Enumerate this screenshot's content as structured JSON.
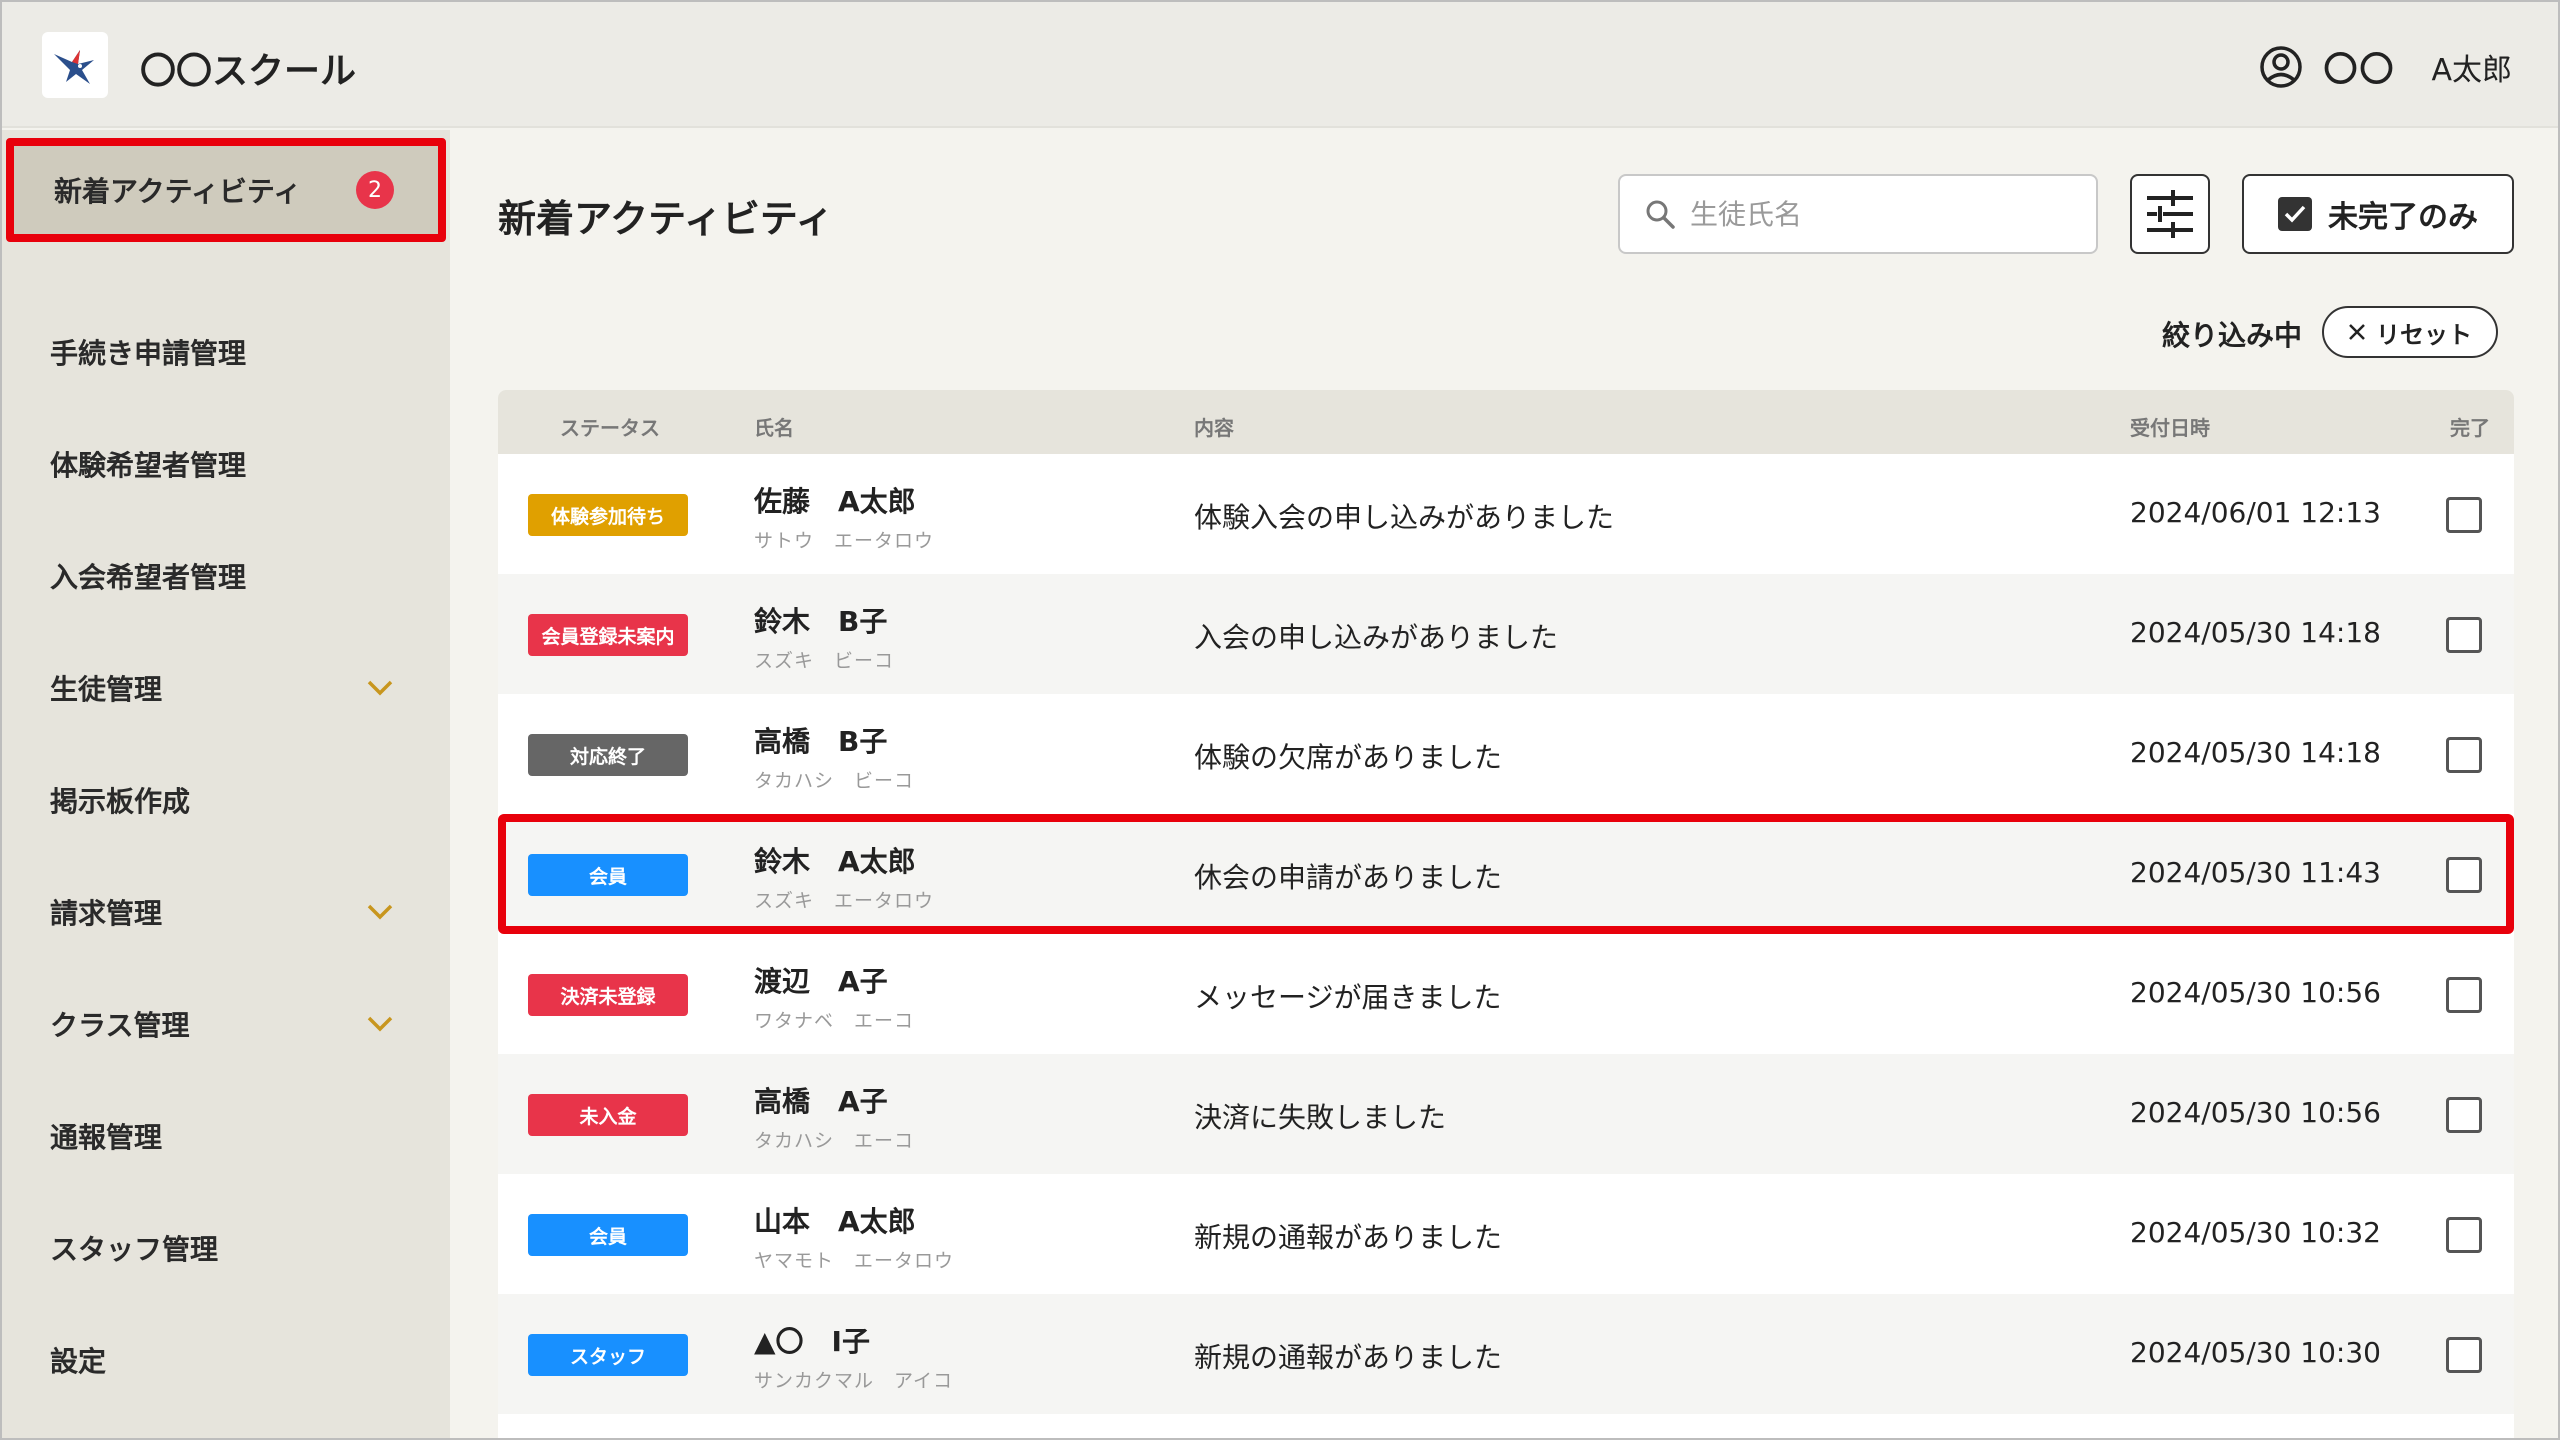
{
  "header": {
    "app_name": "〇〇スクール",
    "user_org": "〇〇",
    "user_name": "A太郎"
  },
  "sidebar": {
    "items": [
      {
        "label": "新着アクティビティ",
        "badge": "2",
        "active": true
      },
      {
        "label": "手続き申請管理"
      },
      {
        "label": "体験希望者管理"
      },
      {
        "label": "入会希望者管理"
      },
      {
        "label": "生徒管理",
        "expandable": true
      },
      {
        "label": "掲示板作成"
      },
      {
        "label": "請求管理",
        "expandable": true
      },
      {
        "label": "クラス管理",
        "expandable": true
      },
      {
        "label": "通報管理"
      },
      {
        "label": "スタッフ管理"
      },
      {
        "label": "設定"
      }
    ]
  },
  "main": {
    "title": "新着アクティビティ",
    "search_placeholder": "生徒氏名",
    "incomplete_only_label": "未完了のみ",
    "filter_status": "絞り込み中",
    "reset_label": "リセット"
  },
  "table": {
    "headers": {
      "status": "ステータス",
      "name": "氏名",
      "content": "内容",
      "date": "受付日時",
      "done": "完了"
    },
    "rows": [
      {
        "status": "体験参加待ち",
        "status_color": "#e0a000",
        "name": "佐藤　A太郎",
        "kana": "サトウ　エータロウ",
        "content": "体験入会の申し込みがありました",
        "date": "2024/06/01 12:13"
      },
      {
        "status": "会員登録未案内",
        "status_color": "#e8344a",
        "name": "鈴木　B子",
        "kana": "スズキ　ビーコ",
        "content": "入会の申し込みがありました",
        "date": "2024/05/30 14:18"
      },
      {
        "status": "対応終了",
        "status_color": "#666666",
        "name": "高橋　B子",
        "kana": "タカハシ　ビーコ",
        "content": "体験の欠席がありました",
        "date": "2024/05/30 14:18"
      },
      {
        "status": "会員",
        "status_color": "#1890ff",
        "name": "鈴木　A太郎",
        "kana": "スズキ　エータロウ",
        "content": "休会の申請がありました",
        "date": "2024/05/30 11:43",
        "highlighted": true
      },
      {
        "status": "決済未登録",
        "status_color": "#e8344a",
        "name": "渡辺　A子",
        "kana": "ワタナベ　エーコ",
        "content": "メッセージが届きました",
        "date": "2024/05/30 10:56"
      },
      {
        "status": "未入金",
        "status_color": "#e8344a",
        "name": "高橋　A子",
        "kana": "タカハシ　エーコ",
        "content": "決済に失敗しました",
        "date": "2024/05/30 10:56"
      },
      {
        "status": "会員",
        "status_color": "#1890ff",
        "name": "山本　A太郎",
        "kana": "ヤマモト　エータロウ",
        "content": "新規の通報がありました",
        "date": "2024/05/30 10:32"
      },
      {
        "status": "スタッフ",
        "status_color": "#1890ff",
        "name": "▲〇　I子",
        "kana": "サンカクマル　アイコ",
        "content": "新規の通報がありました",
        "date": "2024/05/30 10:30"
      }
    ]
  },
  "colors": {
    "highlight": "#e8000b",
    "sidebar_bg": "#e6e4dc",
    "active_bg": "#cfcbbd"
  }
}
